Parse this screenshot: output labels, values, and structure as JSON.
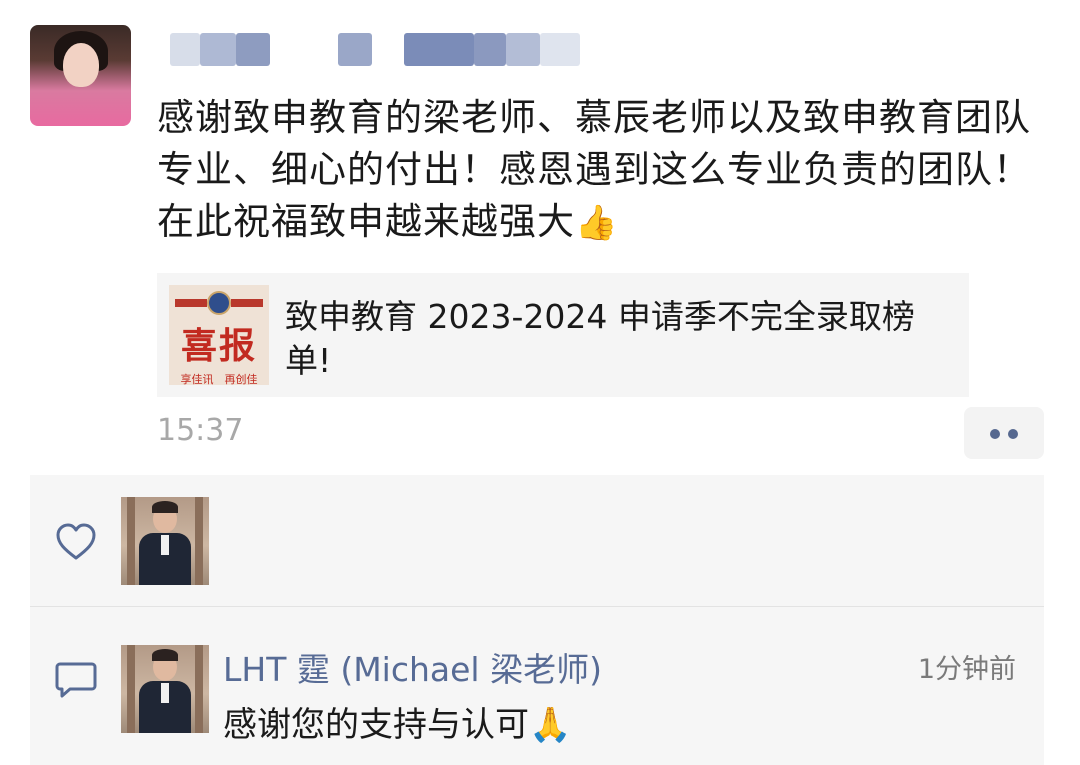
{
  "post": {
    "text": "感谢致申教育的梁老师、慕辰老师以及致申教育团队专业、细心的付出！感恩遇到这么专业负责的团队！在此祝福致申越来越强大",
    "emoji": "👍",
    "link": {
      "title": "致申教育 2023-2024 申请季不完全录取榜单!",
      "thumb_title": "喜报",
      "thumb_caption": "享佳讯　再创佳"
    },
    "time": "15:37"
  },
  "interactions": {
    "comment": {
      "author": "LHT 霆 (Michael 梁老师)",
      "time": "1分钟前",
      "text": "感谢您的支持与认可",
      "emoji": "🙏"
    }
  },
  "icons": {
    "like": "heart-outline-icon",
    "comment": "speech-bubble-icon",
    "more": "more-dots-icon"
  },
  "colors": {
    "link_blue": "#576b95",
    "timestamp_gray": "#a8a8a8",
    "panel_bg": "#f6f6f6"
  }
}
